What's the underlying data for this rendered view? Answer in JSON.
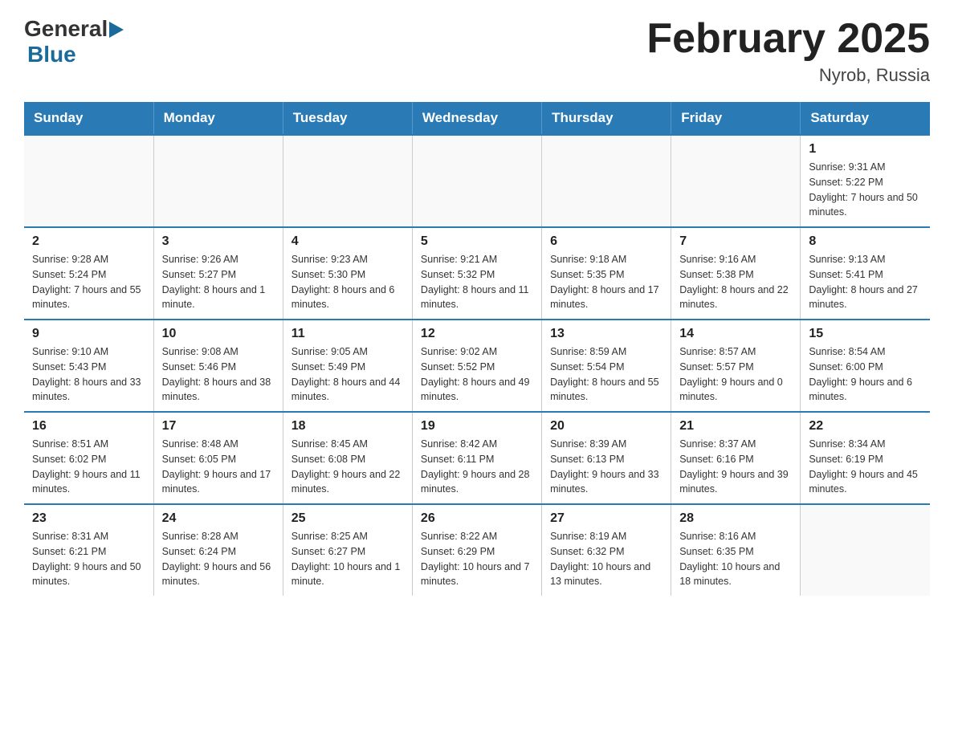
{
  "header": {
    "logo": {
      "general": "General",
      "blue": "Blue"
    },
    "title": "February 2025",
    "location": "Nyrob, Russia"
  },
  "weekdays": [
    "Sunday",
    "Monday",
    "Tuesday",
    "Wednesday",
    "Thursday",
    "Friday",
    "Saturday"
  ],
  "weeks": [
    [
      {
        "day": "",
        "info": ""
      },
      {
        "day": "",
        "info": ""
      },
      {
        "day": "",
        "info": ""
      },
      {
        "day": "",
        "info": ""
      },
      {
        "day": "",
        "info": ""
      },
      {
        "day": "",
        "info": ""
      },
      {
        "day": "1",
        "info": "Sunrise: 9:31 AM\nSunset: 5:22 PM\nDaylight: 7 hours and 50 minutes."
      }
    ],
    [
      {
        "day": "2",
        "info": "Sunrise: 9:28 AM\nSunset: 5:24 PM\nDaylight: 7 hours and 55 minutes."
      },
      {
        "day": "3",
        "info": "Sunrise: 9:26 AM\nSunset: 5:27 PM\nDaylight: 8 hours and 1 minute."
      },
      {
        "day": "4",
        "info": "Sunrise: 9:23 AM\nSunset: 5:30 PM\nDaylight: 8 hours and 6 minutes."
      },
      {
        "day": "5",
        "info": "Sunrise: 9:21 AM\nSunset: 5:32 PM\nDaylight: 8 hours and 11 minutes."
      },
      {
        "day": "6",
        "info": "Sunrise: 9:18 AM\nSunset: 5:35 PM\nDaylight: 8 hours and 17 minutes."
      },
      {
        "day": "7",
        "info": "Sunrise: 9:16 AM\nSunset: 5:38 PM\nDaylight: 8 hours and 22 minutes."
      },
      {
        "day": "8",
        "info": "Sunrise: 9:13 AM\nSunset: 5:41 PM\nDaylight: 8 hours and 27 minutes."
      }
    ],
    [
      {
        "day": "9",
        "info": "Sunrise: 9:10 AM\nSunset: 5:43 PM\nDaylight: 8 hours and 33 minutes."
      },
      {
        "day": "10",
        "info": "Sunrise: 9:08 AM\nSunset: 5:46 PM\nDaylight: 8 hours and 38 minutes."
      },
      {
        "day": "11",
        "info": "Sunrise: 9:05 AM\nSunset: 5:49 PM\nDaylight: 8 hours and 44 minutes."
      },
      {
        "day": "12",
        "info": "Sunrise: 9:02 AM\nSunset: 5:52 PM\nDaylight: 8 hours and 49 minutes."
      },
      {
        "day": "13",
        "info": "Sunrise: 8:59 AM\nSunset: 5:54 PM\nDaylight: 8 hours and 55 minutes."
      },
      {
        "day": "14",
        "info": "Sunrise: 8:57 AM\nSunset: 5:57 PM\nDaylight: 9 hours and 0 minutes."
      },
      {
        "day": "15",
        "info": "Sunrise: 8:54 AM\nSunset: 6:00 PM\nDaylight: 9 hours and 6 minutes."
      }
    ],
    [
      {
        "day": "16",
        "info": "Sunrise: 8:51 AM\nSunset: 6:02 PM\nDaylight: 9 hours and 11 minutes."
      },
      {
        "day": "17",
        "info": "Sunrise: 8:48 AM\nSunset: 6:05 PM\nDaylight: 9 hours and 17 minutes."
      },
      {
        "day": "18",
        "info": "Sunrise: 8:45 AM\nSunset: 6:08 PM\nDaylight: 9 hours and 22 minutes."
      },
      {
        "day": "19",
        "info": "Sunrise: 8:42 AM\nSunset: 6:11 PM\nDaylight: 9 hours and 28 minutes."
      },
      {
        "day": "20",
        "info": "Sunrise: 8:39 AM\nSunset: 6:13 PM\nDaylight: 9 hours and 33 minutes."
      },
      {
        "day": "21",
        "info": "Sunrise: 8:37 AM\nSunset: 6:16 PM\nDaylight: 9 hours and 39 minutes."
      },
      {
        "day": "22",
        "info": "Sunrise: 8:34 AM\nSunset: 6:19 PM\nDaylight: 9 hours and 45 minutes."
      }
    ],
    [
      {
        "day": "23",
        "info": "Sunrise: 8:31 AM\nSunset: 6:21 PM\nDaylight: 9 hours and 50 minutes."
      },
      {
        "day": "24",
        "info": "Sunrise: 8:28 AM\nSunset: 6:24 PM\nDaylight: 9 hours and 56 minutes."
      },
      {
        "day": "25",
        "info": "Sunrise: 8:25 AM\nSunset: 6:27 PM\nDaylight: 10 hours and 1 minute."
      },
      {
        "day": "26",
        "info": "Sunrise: 8:22 AM\nSunset: 6:29 PM\nDaylight: 10 hours and 7 minutes."
      },
      {
        "day": "27",
        "info": "Sunrise: 8:19 AM\nSunset: 6:32 PM\nDaylight: 10 hours and 13 minutes."
      },
      {
        "day": "28",
        "info": "Sunrise: 8:16 AM\nSunset: 6:35 PM\nDaylight: 10 hours and 18 minutes."
      },
      {
        "day": "",
        "info": ""
      }
    ]
  ]
}
